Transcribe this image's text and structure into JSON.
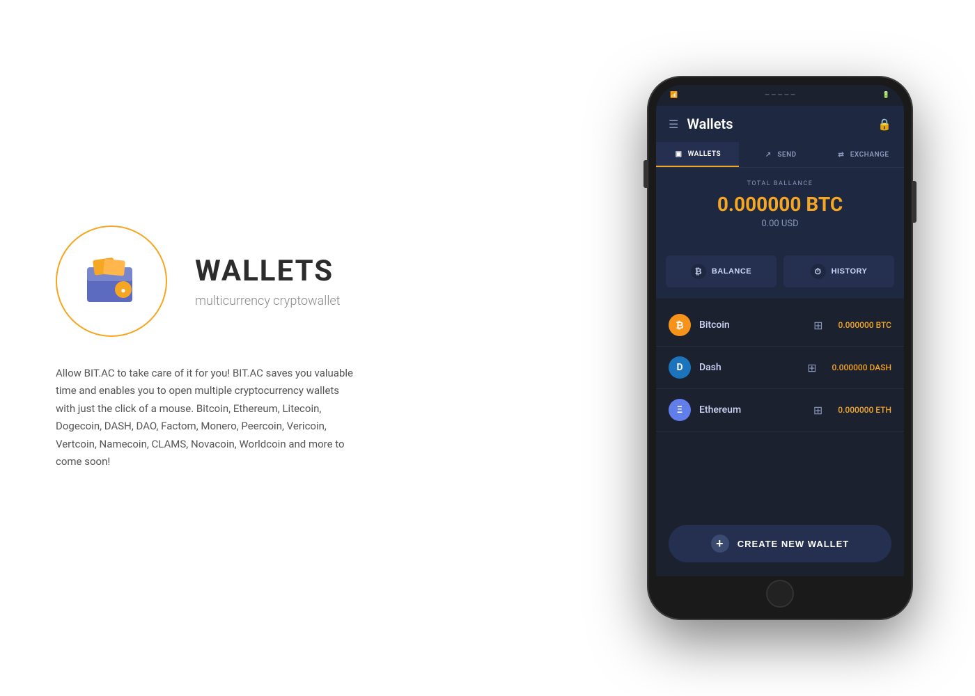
{
  "left": {
    "hero": {
      "title": "WALLETS",
      "subtitle": "multicurrency cryptowallet"
    },
    "description": "Allow BIT.AC to take care of it for you! BIT.AC saves you valuable time and enables you to open multiple cryptocurrency wallets with just the click of a mouse. Bitcoin, Ethereum, Litecoin, Dogecoin, DASH, DAO, Factom, Monero, Peercoin, Vericoin, Vertcoin, Namecoin, CLAMS, Novacoin, Worldcoin and more to come soon!"
  },
  "app": {
    "statusBar": {
      "left": "●",
      "center": "—————",
      "right": "▐▐ ▮"
    },
    "header": {
      "title": "Wallets",
      "icon": "☰",
      "rightIcon": "⊞"
    },
    "tabs": [
      {
        "label": "WALLETS",
        "active": true
      },
      {
        "label": "SEND",
        "active": false
      },
      {
        "label": "EXCHANGE",
        "active": false
      }
    ],
    "balance": {
      "label": "TOTAL BALLANCE",
      "amount": "0.000000 BTC",
      "usd": "0.00 USD"
    },
    "actionButtons": [
      {
        "label": "BALANCE"
      },
      {
        "label": "HISTORY"
      }
    ],
    "wallets": [
      {
        "name": "Bitcoin",
        "symbol": "BTC",
        "balance": "0.000000 BTC",
        "coinClass": "btc",
        "coinLetter": "₿"
      },
      {
        "name": "Dash",
        "symbol": "DASH",
        "balance": "0.000000 DASH",
        "coinClass": "dash",
        "coinLetter": "D"
      },
      {
        "name": "Ethereum",
        "symbol": "ETH",
        "balance": "0.000000 ETH",
        "coinClass": "eth",
        "coinLetter": "Ξ"
      }
    ],
    "createButton": "CREATE NEW WALLET"
  },
  "colors": {
    "accent": "#f5a623",
    "dark": "#1c2130",
    "darkMid": "#1e2840",
    "darkLight": "#253050"
  }
}
